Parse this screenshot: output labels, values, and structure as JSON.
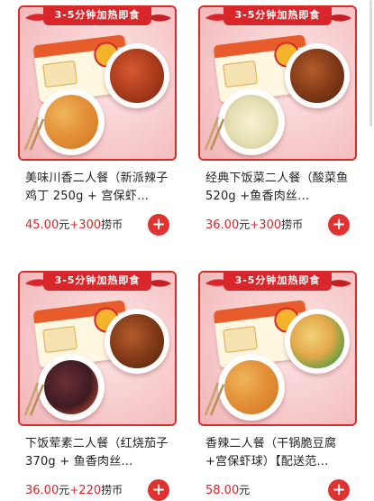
{
  "banner_text": "3-5分钟加热即食",
  "add_button_label": "+",
  "coin_unit": "捞币",
  "currency_unit": "元",
  "plus_sign": "+",
  "products": [
    {
      "title": "美味川香二人餐（新派辣子鸡丁 250g + 宫保虾…",
      "price": "45.00",
      "coins": "300",
      "foods": [
        "kungpao",
        "diced"
      ]
    },
    {
      "title": "经典下饭菜二人餐（酸菜鱼 520g +鱼香肉丝…",
      "price": "36.00",
      "coins": "300",
      "foods": [
        "fish",
        "pork"
      ]
    },
    {
      "title": "下饭荤素二人餐（红烧茄子 370g + 鱼香肉丝…",
      "price": "36.00",
      "coins": "220",
      "foods": [
        "eggplant",
        "pork"
      ]
    },
    {
      "title": "香辣二人餐（干锅脆豆腐+宫保虾球）【配送范…",
      "price": "58.00",
      "coins": "",
      "foods": [
        "kungpao",
        "tofu"
      ]
    }
  ],
  "colors": {
    "accent": "#d8262a",
    "card_bg": "#f8cfd0",
    "add_button": "#e0322e"
  },
  "icons": [
    "chili-pepper-icon",
    "chopsticks-icon",
    "plus-icon"
  ]
}
